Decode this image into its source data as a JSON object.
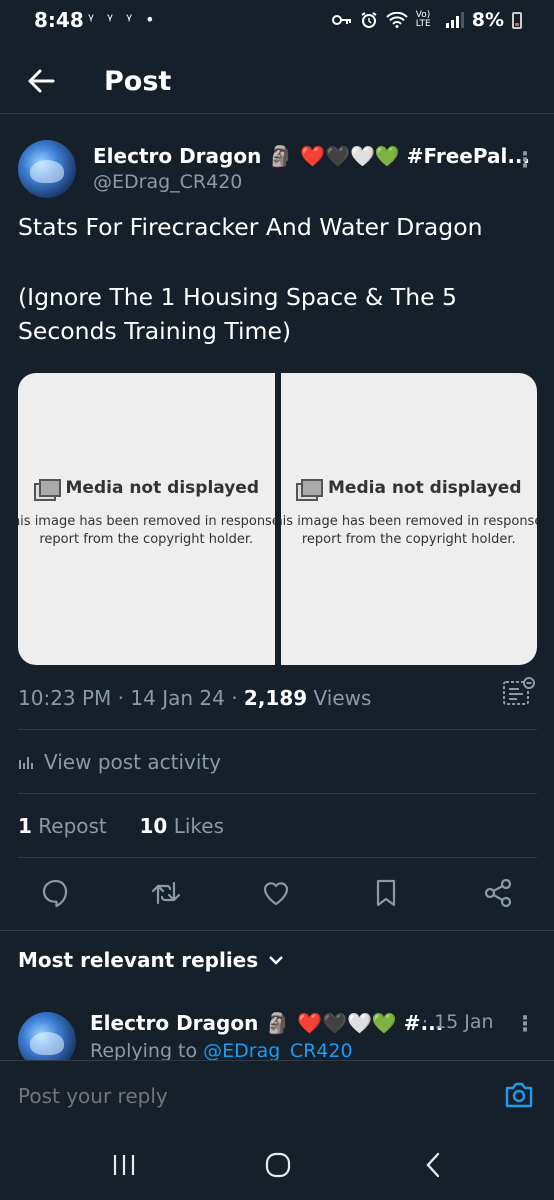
{
  "status_bar": {
    "time": "8:48",
    "notifications": "ᵞ ᵞ ᵞ •",
    "network": "Vo) LTE",
    "battery": "8%"
  },
  "header": {
    "title": "Post"
  },
  "post": {
    "author_name": "Electro Dragon 🗿 ❤️🖤🤍💚 #FreePal...",
    "author_handle": "@EDrag_CR420",
    "text_line1": "Stats For Firecracker And Water Dragon",
    "text_line2": "(Ignore The 1 Housing Space & The 5",
    "text_line3": "Seconds Training Time)",
    "media": [
      {
        "title": "Media not displayed",
        "sub1": "This image has been removed in response to a",
        "sub2": "report from the copyright holder."
      },
      {
        "title": "Media not displayed",
        "sub1": "This image has been removed in response to a",
        "sub2": "report from the copyright holder."
      }
    ],
    "time": "10:23 PM",
    "date": "14 Jan 24",
    "views_count": "2,189",
    "views_label": "Views",
    "activity_label": "View post activity",
    "reposts_count": "1",
    "reposts_label": "Repost",
    "likes_count": "10",
    "likes_label": "Likes"
  },
  "replies": {
    "section_title": "Most relevant replies",
    "first": {
      "author_name": "Electro Dragon 🗿 ❤️🖤🤍💚 #...",
      "date": "· 15 Jan",
      "replying_prefix": "Replying to",
      "replying_handle": "@EDrag_CR420"
    }
  },
  "composer": {
    "placeholder": "Post your reply"
  },
  "colors": {
    "background": "#15202b",
    "accent": "#1d9bf0",
    "muted": "#8b98a5"
  },
  "icons": [
    "back-arrow-icon",
    "kebab-icon",
    "analytics-icon",
    "activity-icon",
    "reply-icon",
    "repost-icon",
    "like-icon",
    "bookmark-icon",
    "share-icon",
    "chevron-down-icon",
    "camera-icon",
    "recents-icon",
    "home-icon",
    "nav-back-icon"
  ]
}
